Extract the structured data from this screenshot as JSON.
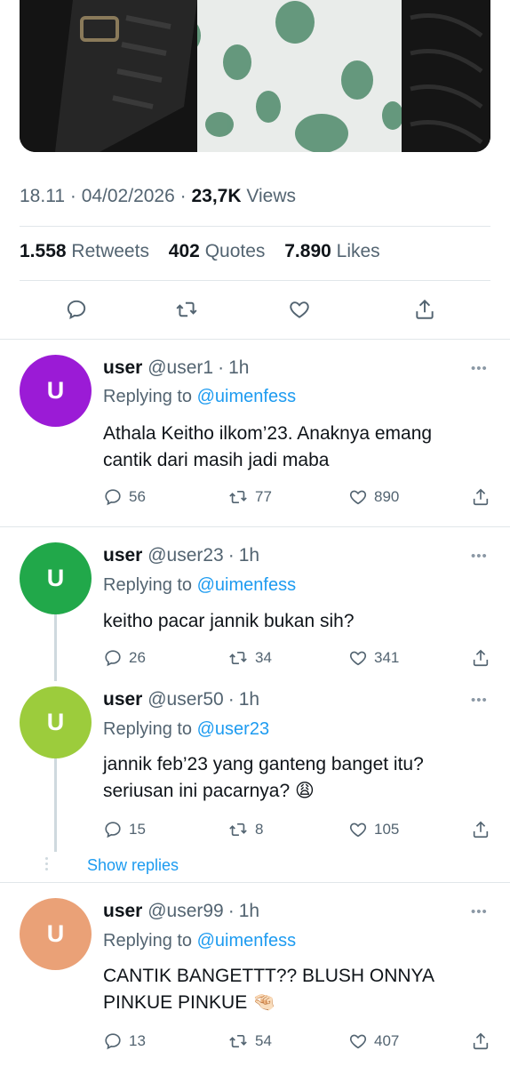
{
  "tweet": {
    "time": "18.11",
    "date": "04/02/2026",
    "views_count": "23,7K",
    "views_label": "Views",
    "sep": "·",
    "retweets_count": "1.558",
    "retweets_label": "Retweets",
    "quotes_count": "402",
    "quotes_label": "Quotes",
    "likes_count": "7.890",
    "likes_label": "Likes"
  },
  "icons": {
    "reply": "reply-icon",
    "retweet": "retweet-icon",
    "like": "heart-icon",
    "share": "share-icon",
    "more": "more-icon"
  },
  "colors": {
    "link": "#1d9bf0",
    "secondary": "#536471",
    "avatar1": "#9b1bd6",
    "avatar2": "#21a84a",
    "avatar3": "#9ccc3c",
    "avatar4": "#eaa177"
  },
  "replies": [
    {
      "avatar_letter": "U",
      "name": "user",
      "handle": "@user1",
      "time": "1h",
      "replying_label": "Replying to",
      "replying_to": "@uimenfess",
      "text_line1": "Athala Keitho ilkom’23. Anaknya emang",
      "text_line2": "cantik dari masih jadi maba",
      "replies": "56",
      "retweets": "77",
      "likes": "890"
    },
    {
      "avatar_letter": "U",
      "name": "user",
      "handle": "@user23",
      "time": "1h",
      "replying_label": "Replying to",
      "replying_to": "@uimenfess",
      "text_line1": "keitho pacar jannik bukan sih?",
      "replies": "26",
      "retweets": "34",
      "likes": "341"
    },
    {
      "avatar_letter": "U",
      "name": "user",
      "handle": "@user50",
      "time": "1h",
      "replying_label": "Replying to",
      "replying_to": "@user23",
      "text_line1": "jannik feb’23 yang ganteng banget itu?",
      "text_line2": "seriusan ini pacarnya? 😩",
      "replies": "15",
      "retweets": "8",
      "likes": "105"
    },
    {
      "avatar_letter": "U",
      "name": "user",
      "handle": "@user99",
      "time": "1h",
      "replying_label": "Replying to",
      "replying_to": "@uimenfess",
      "text_line1": "CANTIK BANGETTT?? BLUSH ONNYA",
      "text_line2": "PINKUE PINKUE 🤏🏻",
      "replies": "13",
      "retweets": "54",
      "likes": "407"
    }
  ],
  "show_replies": "Show replies"
}
